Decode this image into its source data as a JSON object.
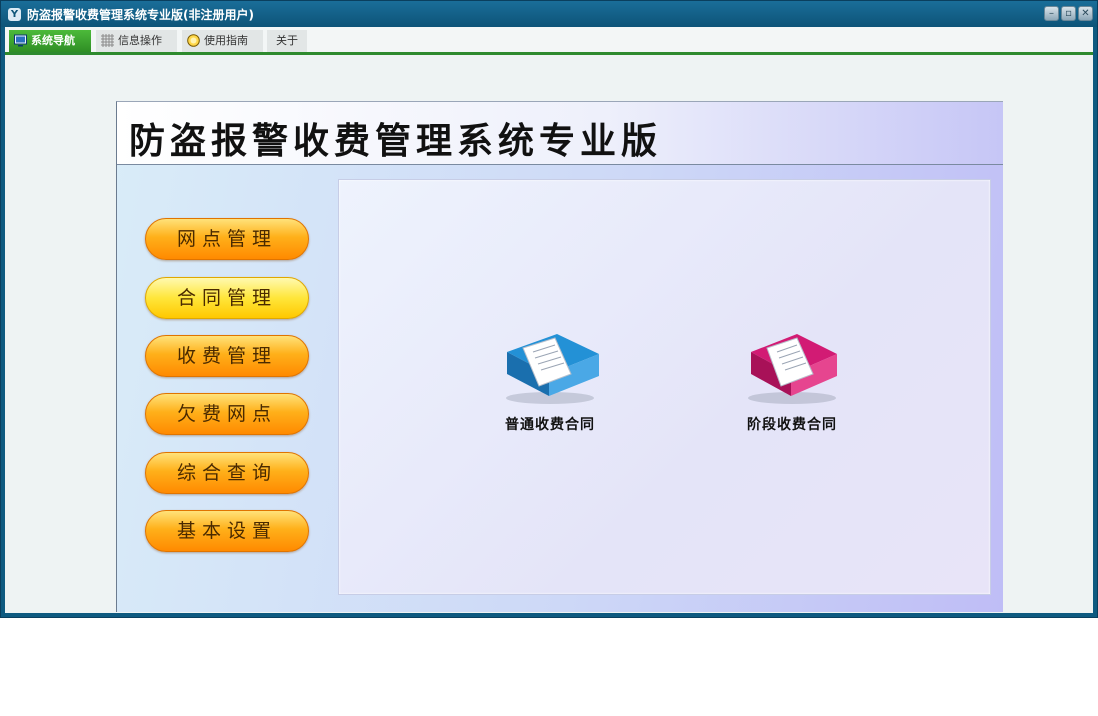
{
  "window": {
    "title": "防盗报警收费管理系统专业版(非注册用户)",
    "icon_glyph": "Y",
    "controls": [
      "minimize-icon",
      "restore-icon",
      "close-icon"
    ],
    "control_glyphs": {
      "minimize": "–",
      "restore": "▫",
      "close": "✕"
    }
  },
  "tabs": [
    {
      "label": "系统导航",
      "icon": "monitor-icon",
      "active": true
    },
    {
      "label": "信息操作",
      "icon": "grid-icon",
      "active": false
    },
    {
      "label": "使用指南",
      "icon": "help-globe-icon",
      "active": false
    },
    {
      "label": "关于",
      "icon": "",
      "active": false
    }
  ],
  "banner": {
    "title": "防盗报警收费管理系统专业版"
  },
  "nav_buttons": [
    {
      "label": "网点管理",
      "selected": false
    },
    {
      "label": "合同管理",
      "selected": true
    },
    {
      "label": "收费管理",
      "selected": false
    },
    {
      "label": "欠费网点",
      "selected": false
    },
    {
      "label": "综合查询",
      "selected": false
    },
    {
      "label": "基本设置",
      "selected": false
    }
  ],
  "content_items": [
    {
      "label": "普通收费合同",
      "icon": "blue-contract-book-icon",
      "color": "#1b86c8"
    },
    {
      "label": "阶段收费合同",
      "icon": "pink-contract-book-icon",
      "color": "#c8186a"
    }
  ],
  "colors": {
    "accent_green": "#2e8a2e",
    "title_bar": "#0d5478",
    "button_orange": "#ff9a00"
  }
}
